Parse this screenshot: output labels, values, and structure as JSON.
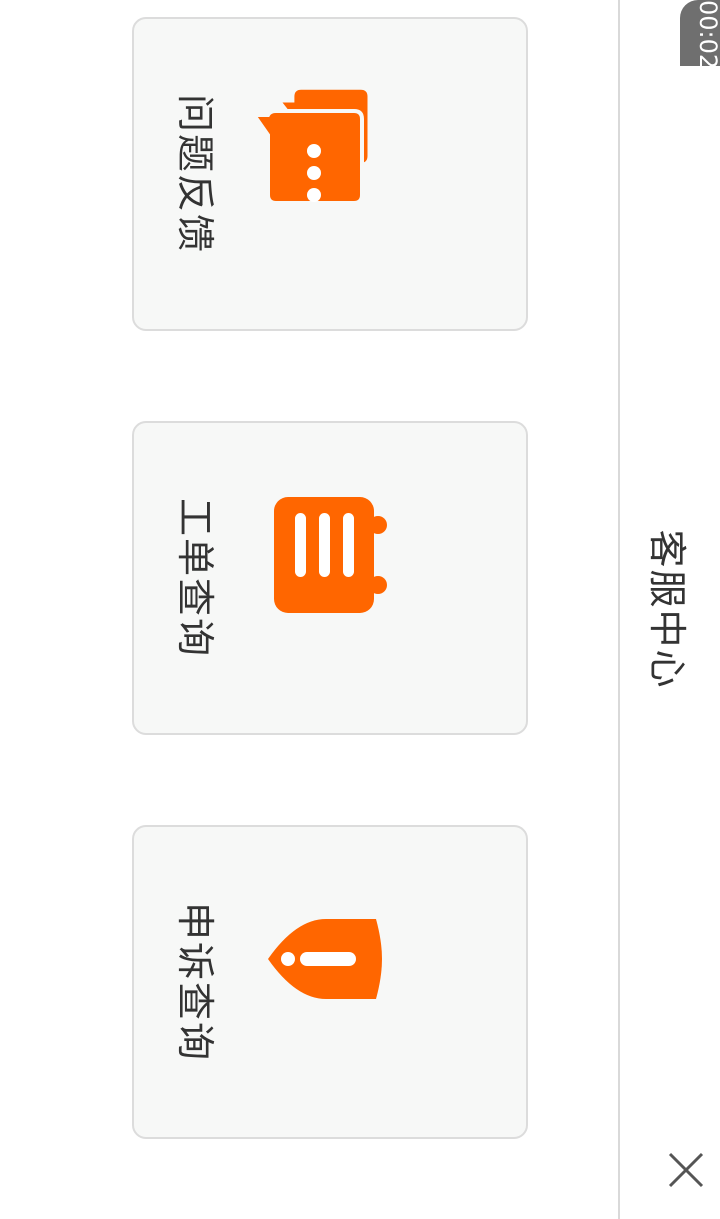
{
  "header": {
    "title": "客服中心",
    "timer": "00:02"
  },
  "cards": [
    {
      "label": "问题反馈",
      "icon": "chat-bubbles-icon"
    },
    {
      "label": "工单查询",
      "icon": "ticket-list-icon"
    },
    {
      "label": "申诉查询",
      "icon": "shield-alert-icon"
    }
  ],
  "colors": {
    "accent": "#FF6600",
    "card_bg": "#F7F8F7",
    "text": "#333333"
  }
}
